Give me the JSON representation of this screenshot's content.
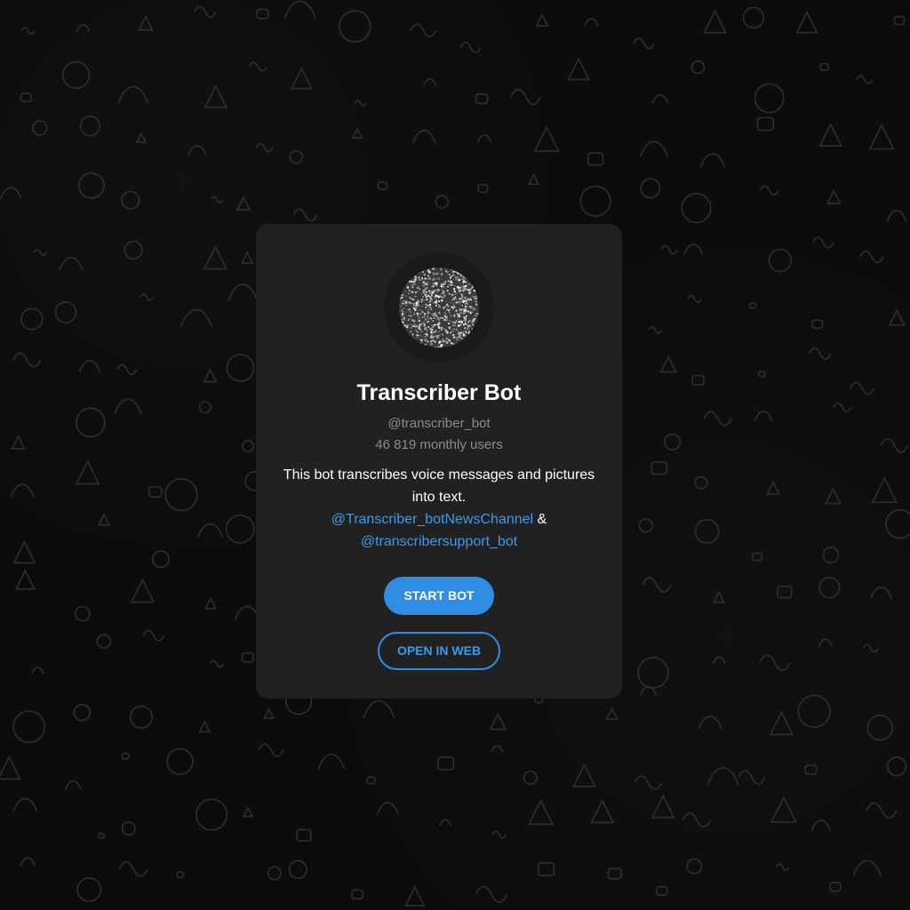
{
  "bot": {
    "name": "Transcriber Bot",
    "username": "@transcriber_bot",
    "monthly_users": "46 819 monthly users",
    "description_line1": "This bot transcribes voice messages and pictures into text.",
    "link_channel": "@Transcriber_botNewsChannel",
    "separator": " & ",
    "link_support": "@transcribersupport_bot"
  },
  "actions": {
    "start_label": "START BOT",
    "web_label": "OPEN IN WEB"
  },
  "colors": {
    "background": "#0c0c0c",
    "card": "#212121",
    "accent": "#2f8de4",
    "link": "#3d9ae8",
    "muted": "#8c8c8c"
  },
  "icons": {
    "background_pattern": "doodle-pattern-icon",
    "avatar": "noise-circle-avatar-icon"
  }
}
